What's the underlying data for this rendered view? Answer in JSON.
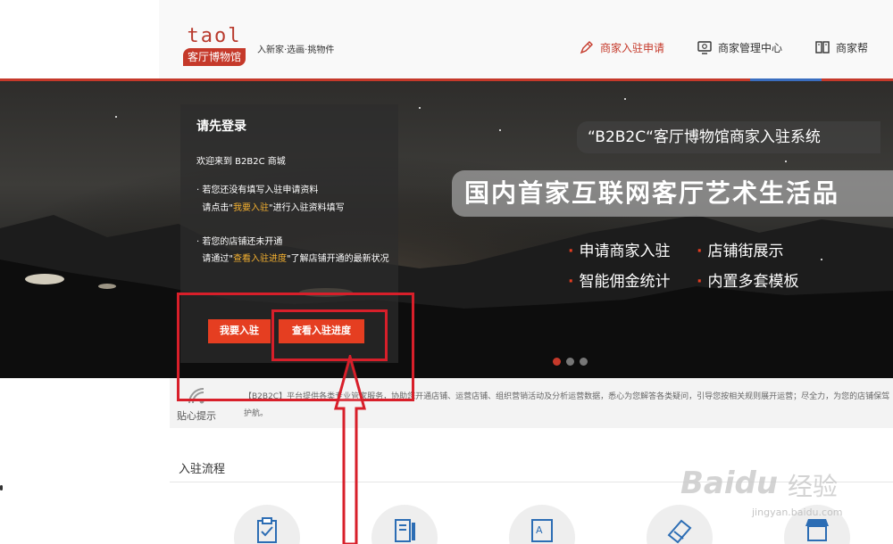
{
  "header": {
    "logo_top": "taol",
    "logo_badge": "客厅博物馆",
    "slogan": "入新家·选画·挑物件",
    "nav": [
      {
        "label": "商家入驻申请",
        "icon": "pen-icon",
        "active": true
      },
      {
        "label": "商家管理中心",
        "icon": "monitor-icon",
        "active": false
      },
      {
        "label": "商家帮",
        "icon": "book-icon",
        "active": false
      }
    ],
    "accent_color": "#c5392a"
  },
  "login_panel": {
    "title": "请先登录",
    "welcome": "欢迎来到 B2B2C 商城",
    "p1_prefix": "· 若您还没有填写入驻申请资料",
    "p1_line2_a": "请点击\"",
    "p1_link": "我要入驻",
    "p1_line2_b": "\"进行入驻资料填写",
    "p2_prefix": "· 若您的店铺还未开通",
    "p2_a": "请通过\"",
    "p2_link": "查看入驻进度",
    "p2_b": "\"了解店铺开通的最新状况",
    "btn_join": "我要入驻",
    "btn_progress": "查看入驻进度"
  },
  "banner": {
    "tagline": "“B2B2C“客厅博物馆商家入驻系统",
    "headline": "国内首家互联网客厅艺术生活品",
    "features": [
      "申请商家入驻",
      "店铺街展示",
      "智能佣金统计",
      "内置多套模板"
    ],
    "slide_count": 3,
    "active_slide": 0
  },
  "tips": {
    "label": "贴心提示",
    "text": "【B2B2C】平台提供各类专业管家服务，协助您开通店铺、运营店铺、组织营销活动及分析运营数据，悉心为您解答各类疑问，引导您按相关规则展开运营；尽全力，为您的店铺保驾护航。"
  },
  "process": {
    "title": "入驻流程",
    "steps": [
      "clipboard-icon",
      "document-icon",
      "certificate-icon",
      "card-icon",
      "store-icon"
    ]
  },
  "watermark": {
    "brand": "Bai",
    "brand2": "du",
    "cn": "经验",
    "url": "jingyan.baidu.com"
  }
}
